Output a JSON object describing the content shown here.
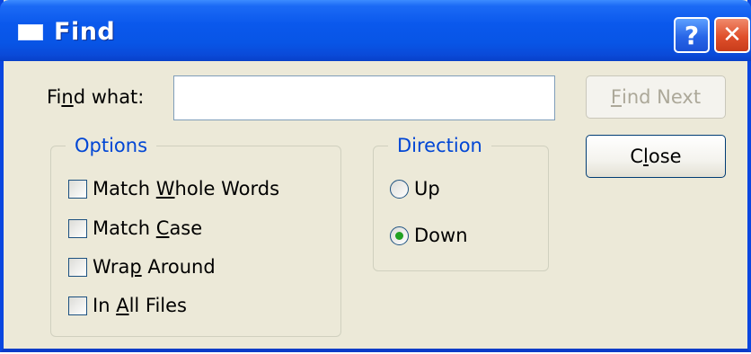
{
  "window": {
    "title": "Find",
    "icon": "window-icon",
    "help_label": "?",
    "close_label": "✕"
  },
  "find": {
    "label_pre": "Fi",
    "label_u": "n",
    "label_post": "d what:",
    "value": "",
    "placeholder": ""
  },
  "buttons": {
    "find_next_u": "F",
    "find_next_rest": "ind Next",
    "close_pre": "C",
    "close_u": "l",
    "close_post": "ose"
  },
  "options": {
    "legend": "Options",
    "items": [
      {
        "pre": "Match ",
        "u": "W",
        "post": "hole Words",
        "checked": false
      },
      {
        "pre": "Match ",
        "u": "C",
        "post": "ase",
        "checked": false
      },
      {
        "pre": "Wra",
        "u": "p",
        "post": " Around",
        "checked": false
      },
      {
        "pre": "In ",
        "u": "A",
        "post": "ll Files",
        "checked": false
      }
    ]
  },
  "direction": {
    "legend": "Direction",
    "items": [
      {
        "label": "Up",
        "selected": false
      },
      {
        "label": "Down",
        "selected": true
      }
    ]
  },
  "colors": {
    "titlebar": "#0855e6",
    "dialog_bg": "#ece9d8",
    "group_legend": "#0046d5",
    "radio_selected": "#21a121"
  }
}
